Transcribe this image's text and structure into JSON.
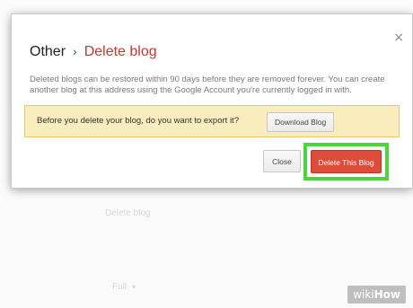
{
  "dialog": {
    "title_section": "Other",
    "title_separator": "›",
    "title_page": "Delete blog",
    "close_glyph": "×",
    "description": "Deleted blogs can be restored within 90 days before they are removed forever. You can create another blog at this address using the Google Account you're currently logged in with.",
    "export_prompt": "Before you delete your blog, do you want to export it?",
    "download_button": "Download Blog",
    "close_button": "Close",
    "delete_button": "Delete This Blog"
  },
  "background": {
    "delete_link": "Delete blog",
    "full_select": "Full"
  },
  "watermark": {
    "brand_prefix": "wiki",
    "brand_suffix": "How"
  },
  "colors": {
    "title_accent": "#c4372d",
    "delete_button": "#dd4b39",
    "highlight_border": "#4ad63a",
    "export_box": "#f9edbe"
  },
  "icons": {
    "close": "close-icon",
    "select_chevron": "chevron-down-icon"
  }
}
